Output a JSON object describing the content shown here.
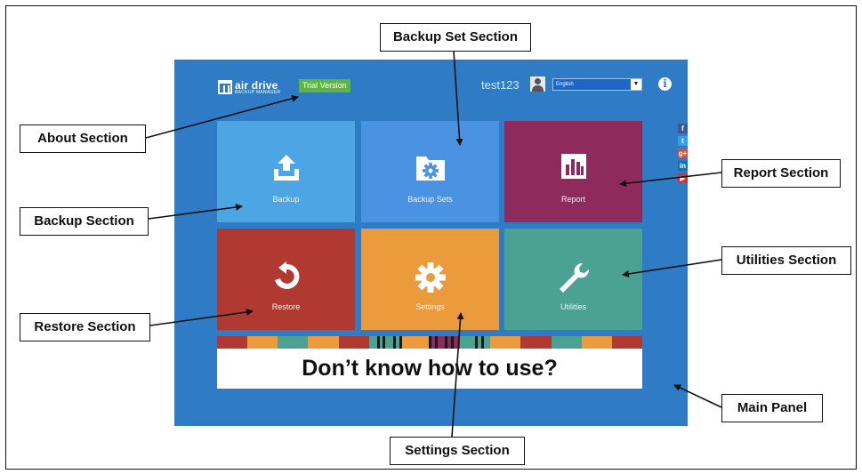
{
  "header": {
    "logo_name": "air drive",
    "logo_sub": "BACKUP MANAGER",
    "trial_badge": "Trial Version",
    "username": "test123",
    "language": "English",
    "info_glyph": "i"
  },
  "tiles": [
    {
      "label": "Backup",
      "color": "#4da5e3",
      "icon": "upload-icon"
    },
    {
      "label": "Backup Sets",
      "color": "#4a93e3",
      "icon": "folder-gear-icon"
    },
    {
      "label": "Report",
      "color": "#8e2a5c",
      "icon": "bar-chart-icon"
    },
    {
      "label": "Restore",
      "color": "#b03a32",
      "icon": "restore-icon"
    },
    {
      "label": "Settings",
      "color": "#eb9a3c",
      "icon": "gear-icon"
    },
    {
      "label": "Utilities",
      "color": "#4ba192",
      "icon": "wrench-icon"
    }
  ],
  "social": [
    {
      "glyph": "f",
      "color": "#3b5998",
      "icon": "facebook-icon"
    },
    {
      "glyph": "t",
      "color": "#2aa3ef",
      "icon": "twitter-icon"
    },
    {
      "glyph": "g+",
      "color": "#dd4b39",
      "icon": "googleplus-icon"
    },
    {
      "glyph": "in",
      "color": "#0e76a8",
      "icon": "linkedin-icon"
    },
    {
      "glyph": "▶",
      "color": "#e52d27",
      "icon": "youtube-icon"
    }
  ],
  "banner": {
    "text": "Don’t know how to use?",
    "stripe_colors": [
      "#b03a32",
      "#eb9a3c",
      "#4ba192",
      "#eb9a3c",
      "#b03a32",
      "#4ba192",
      "#eb9a3c",
      "#8e2a5c",
      "#4ba192",
      "#eb9a3c",
      "#b03a32",
      "#4ba192",
      "#eb9a3c",
      "#b03a32"
    ]
  },
  "callouts": {
    "backup_set": "Backup Set Section",
    "about": "About Section",
    "report": "Report Section",
    "backup": "Backup Section",
    "utilities": "Utilities Section",
    "restore": "Restore Section",
    "main_panel": "Main Panel",
    "settings": "Settings Section"
  }
}
